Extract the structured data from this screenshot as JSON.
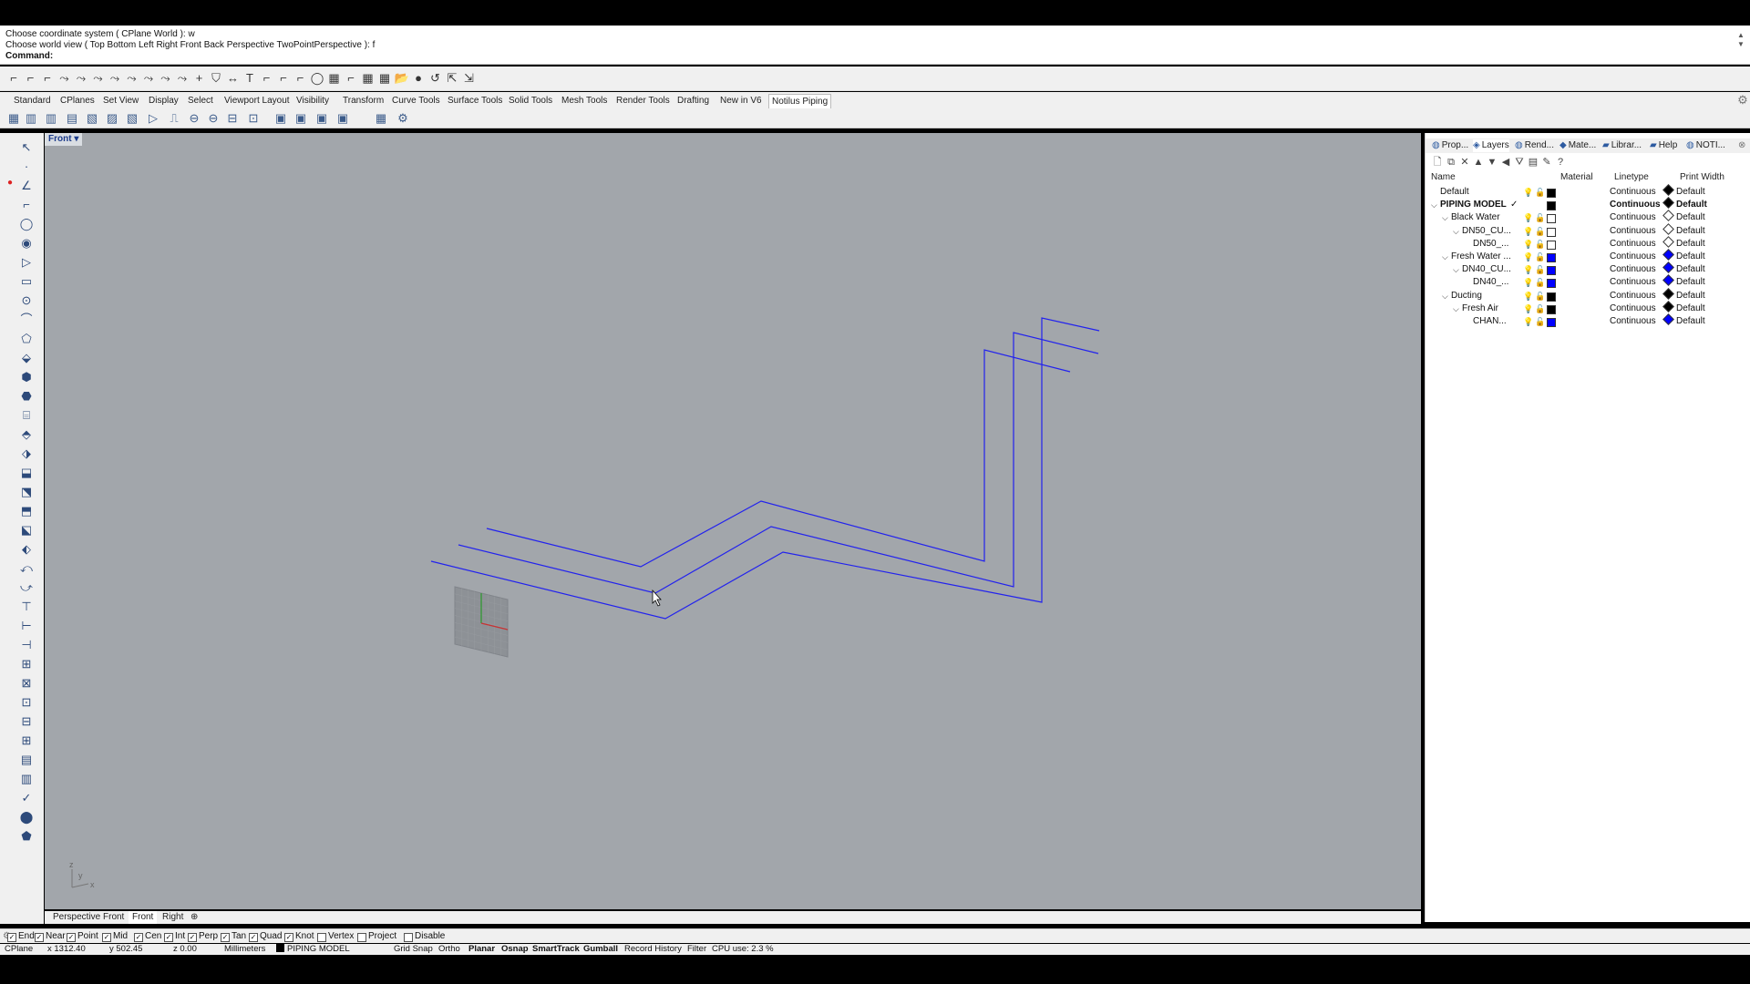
{
  "command": {
    "history": [
      "Choose coordinate system ( CPlane  World ): w",
      "Choose world view ( Top  Bottom  Left  Right  Front  Back  Perspective  TwoPointPerspective ): f"
    ],
    "prompt": "Command:"
  },
  "toolbar_tabs": [
    "Standard",
    "CPlanes",
    "Set View",
    "Display",
    "Select",
    "Viewport Layout",
    "Visibility",
    "Transform",
    "Curve Tools",
    "Surface Tools",
    "Solid Tools",
    "Mesh Tools",
    "Render Tools",
    "Drafting",
    "New in V6",
    "Notilus Piping"
  ],
  "active_tab": "Notilus Piping",
  "viewport": {
    "title": "Front",
    "axes_labels": {
      "z": "z",
      "y": "y",
      "x": "x"
    }
  },
  "viewport_tabs": [
    "Perspective",
    "Front",
    "Front",
    "Right"
  ],
  "active_viewport_tab": "Front",
  "osnaps": [
    {
      "label": "End",
      "checked": true
    },
    {
      "label": "Near",
      "checked": true
    },
    {
      "label": "Point",
      "checked": true
    },
    {
      "label": "Mid",
      "checked": true
    },
    {
      "label": "Cen",
      "checked": true
    },
    {
      "label": "Int",
      "checked": true
    },
    {
      "label": "Perp",
      "checked": true
    },
    {
      "label": "Tan",
      "checked": true
    },
    {
      "label": "Quad",
      "checked": true
    },
    {
      "label": "Knot",
      "checked": true
    },
    {
      "label": "Vertex",
      "checked": false
    },
    {
      "label": "Project",
      "checked": false
    },
    {
      "label": "Disable",
      "checked": false
    }
  ],
  "status": {
    "cplane": "CPlane",
    "x": "x 1312.40",
    "y": "y 502.45",
    "z": "z 0.00",
    "units": "Millimeters",
    "layer": "PIPING MODEL",
    "toggles": [
      "Grid Snap",
      "Ortho",
      "Planar",
      "Osnap",
      "SmartTrack",
      "Gumball",
      "Record History",
      "Filter"
    ],
    "bold_toggles": [
      "Planar",
      "Osnap",
      "SmartTrack",
      "Gumball"
    ],
    "cpu": "CPU use: 2.3 %"
  },
  "panel_tabs": [
    "Prop...",
    "Layers",
    "Rend...",
    "Mate...",
    "Librar...",
    "Help",
    "NOTI..."
  ],
  "active_panel_tab": "Layers",
  "layer_columns": {
    "name": "Name",
    "material": "Material",
    "linetype": "Linetype",
    "print_width": "Print Width"
  },
  "layers": [
    {
      "name": "Default",
      "caret": "",
      "color": "#000000",
      "linetype": "Continuous",
      "print_width": "Default",
      "bold": false,
      "current": false,
      "pw_color": "#000000"
    },
    {
      "name": "PIPING MODEL",
      "caret": "v",
      "color": "#000000",
      "linetype": "Continuous",
      "print_width": "Default",
      "bold": true,
      "current": true,
      "pw_color": "#000000"
    },
    {
      "name": "Black Water",
      "caret": "v",
      "color": "#ffffff",
      "linetype": "Continuous",
      "print_width": "Default",
      "bold": false,
      "current": false,
      "pw_color": "#ffffff"
    },
    {
      "name": "DN50_CU...",
      "caret": "v",
      "color": "#ffffff",
      "linetype": "Continuous",
      "print_width": "Default",
      "bold": false,
      "current": false,
      "pw_color": "#ffffff"
    },
    {
      "name": "DN50_...",
      "caret": "",
      "color": "#ffffff",
      "linetype": "Continuous",
      "print_width": "Default",
      "bold": false,
      "current": false,
      "pw_color": "#ffffff"
    },
    {
      "name": "Fresh Water ...",
      "caret": "v",
      "color": "#0000ff",
      "linetype": "Continuous",
      "print_width": "Default",
      "bold": false,
      "current": false,
      "pw_color": "#0000ff"
    },
    {
      "name": "DN40_CU...",
      "caret": "v",
      "color": "#0000ff",
      "linetype": "Continuous",
      "print_width": "Default",
      "bold": false,
      "current": false,
      "pw_color": "#0000ff"
    },
    {
      "name": "DN40_...",
      "caret": "",
      "color": "#0000ff",
      "linetype": "Continuous",
      "print_width": "Default",
      "bold": false,
      "current": false,
      "pw_color": "#0000ff"
    },
    {
      "name": "Ducting",
      "caret": "v",
      "color": "#000000",
      "linetype": "Continuous",
      "print_width": "Default",
      "bold": false,
      "current": false,
      "pw_color": "#000000"
    },
    {
      "name": "Fresh Air",
      "caret": "v",
      "color": "#000000",
      "linetype": "Continuous",
      "print_width": "Default",
      "bold": false,
      "current": false,
      "pw_color": "#000000"
    },
    {
      "name": "CHAN...",
      "caret": "",
      "color": "#0000ff",
      "linetype": "Continuous",
      "print_width": "Default",
      "bold": false,
      "current": false,
      "pw_color": "#0000ff"
    }
  ],
  "colors": {
    "curve": "#2222ee",
    "viewport_bg": "#a2a6ab",
    "accent": "#1a3a8a"
  }
}
